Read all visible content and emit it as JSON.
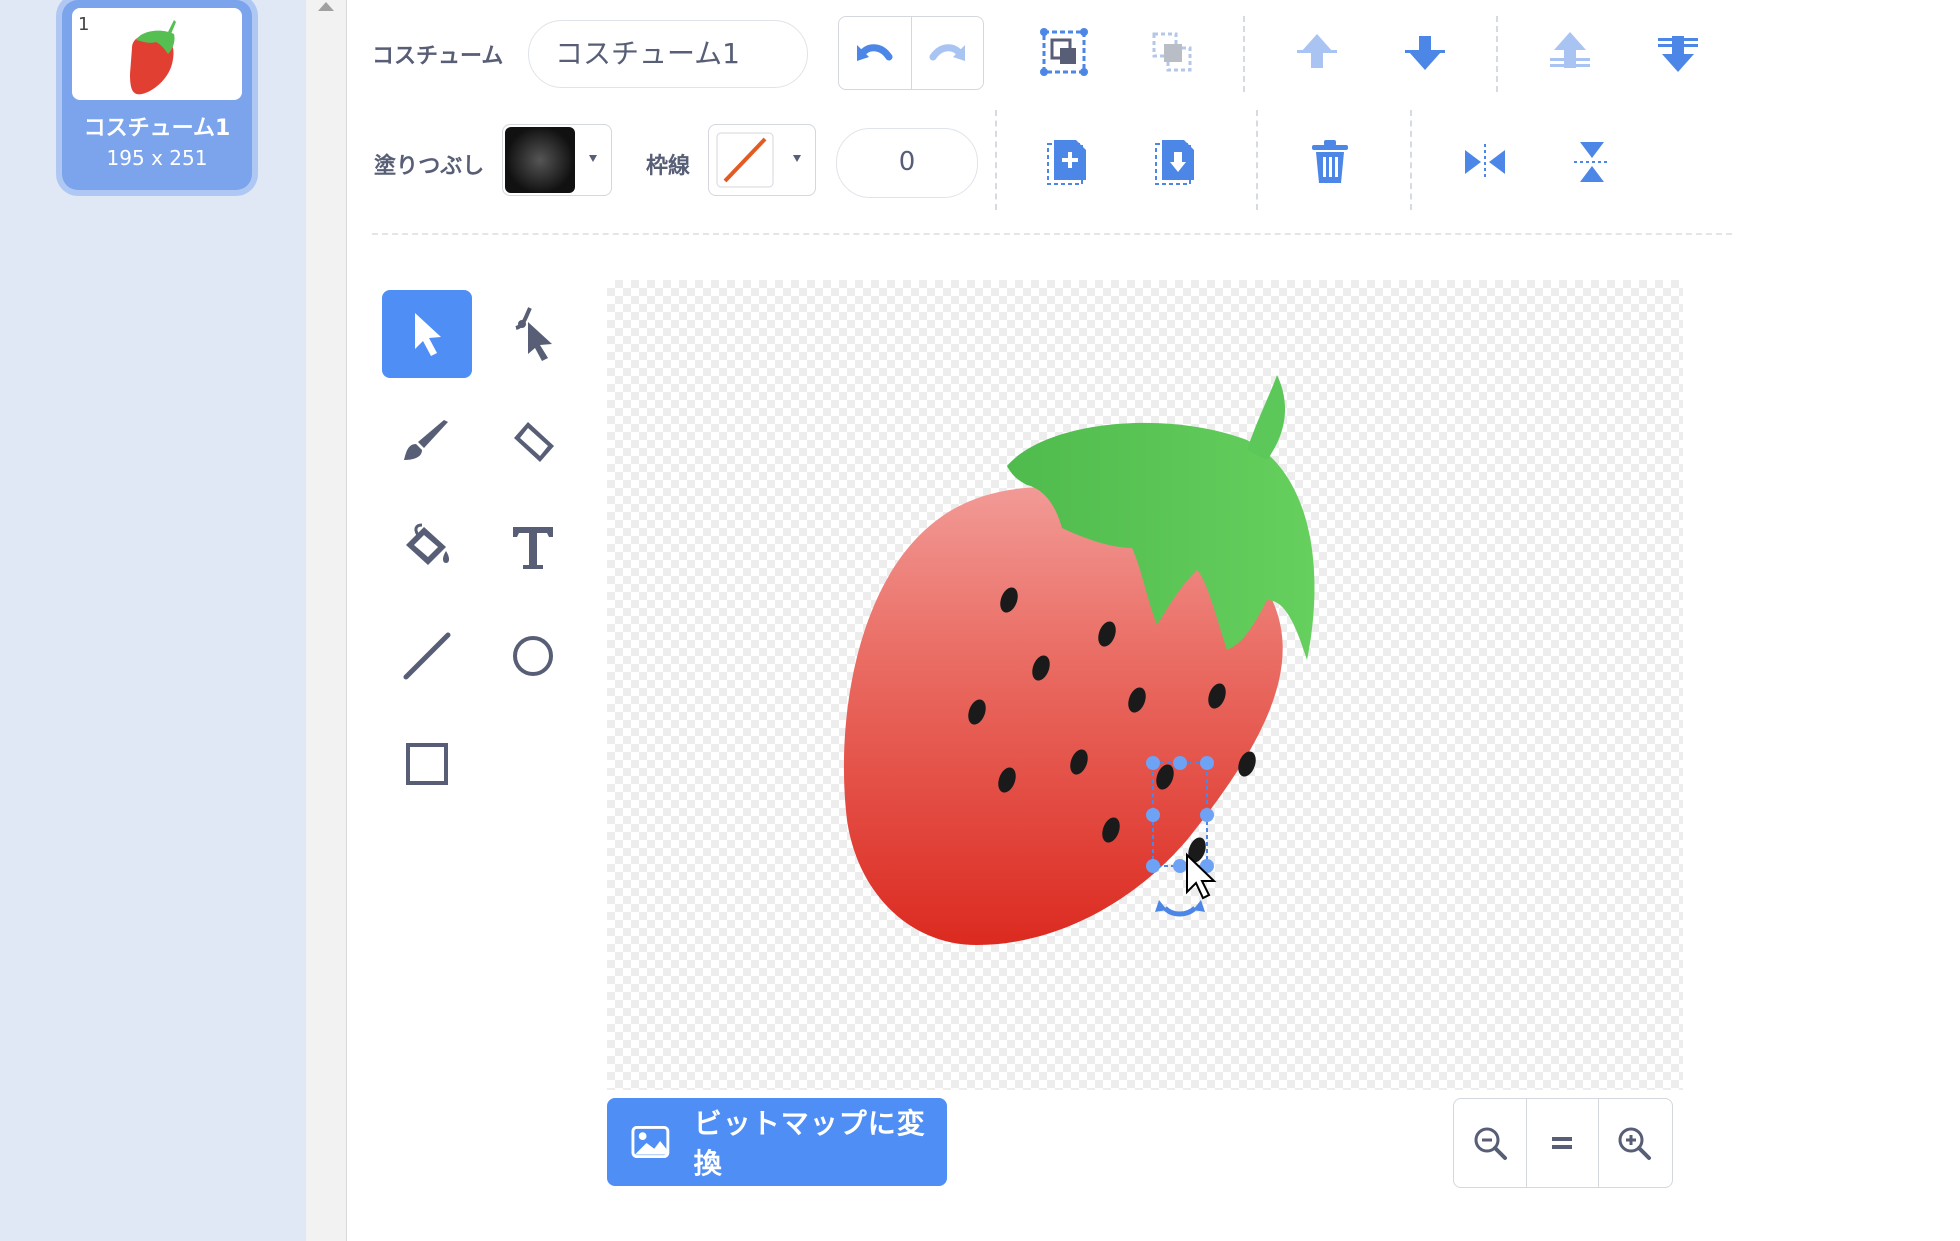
{
  "costume_list": {
    "items": [
      {
        "number": "1",
        "name": "コスチューム1",
        "size": "195 x 251",
        "selected": true
      }
    ]
  },
  "toolbar": {
    "costume_label": "コスチューム",
    "costume_name": "コスチューム1",
    "fill_label": "塗りつぶし",
    "outline_label": "枠線",
    "outline_width": "0",
    "fill_color": "#000000",
    "outline_color": "none",
    "buttons": [
      "undo",
      "redo",
      "group",
      "ungroup",
      "forward",
      "backward",
      "front",
      "back",
      "copy",
      "paste",
      "delete",
      "flip-horizontal",
      "flip-vertical"
    ]
  },
  "tools": [
    {
      "name": "select",
      "active": true
    },
    {
      "name": "reshape",
      "active": false
    },
    {
      "name": "brush",
      "active": false
    },
    {
      "name": "eraser",
      "active": false
    },
    {
      "name": "fill",
      "active": false
    },
    {
      "name": "text",
      "active": false
    },
    {
      "name": "line",
      "active": false
    },
    {
      "name": "circle",
      "active": false
    },
    {
      "name": "rectangle",
      "active": false
    }
  ],
  "canvas": {
    "content": "strawberry"
  },
  "footer": {
    "convert_label": "ビットマップに変換",
    "zoom": {
      "out": "-",
      "reset": "=",
      "in": "+"
    }
  },
  "colors": {
    "accent": "#4f8ef5",
    "text": "#575e75",
    "pane": "#e0e8f5",
    "strawberry_red": "#e63a2e",
    "leaf_green": "#5cc35a"
  }
}
